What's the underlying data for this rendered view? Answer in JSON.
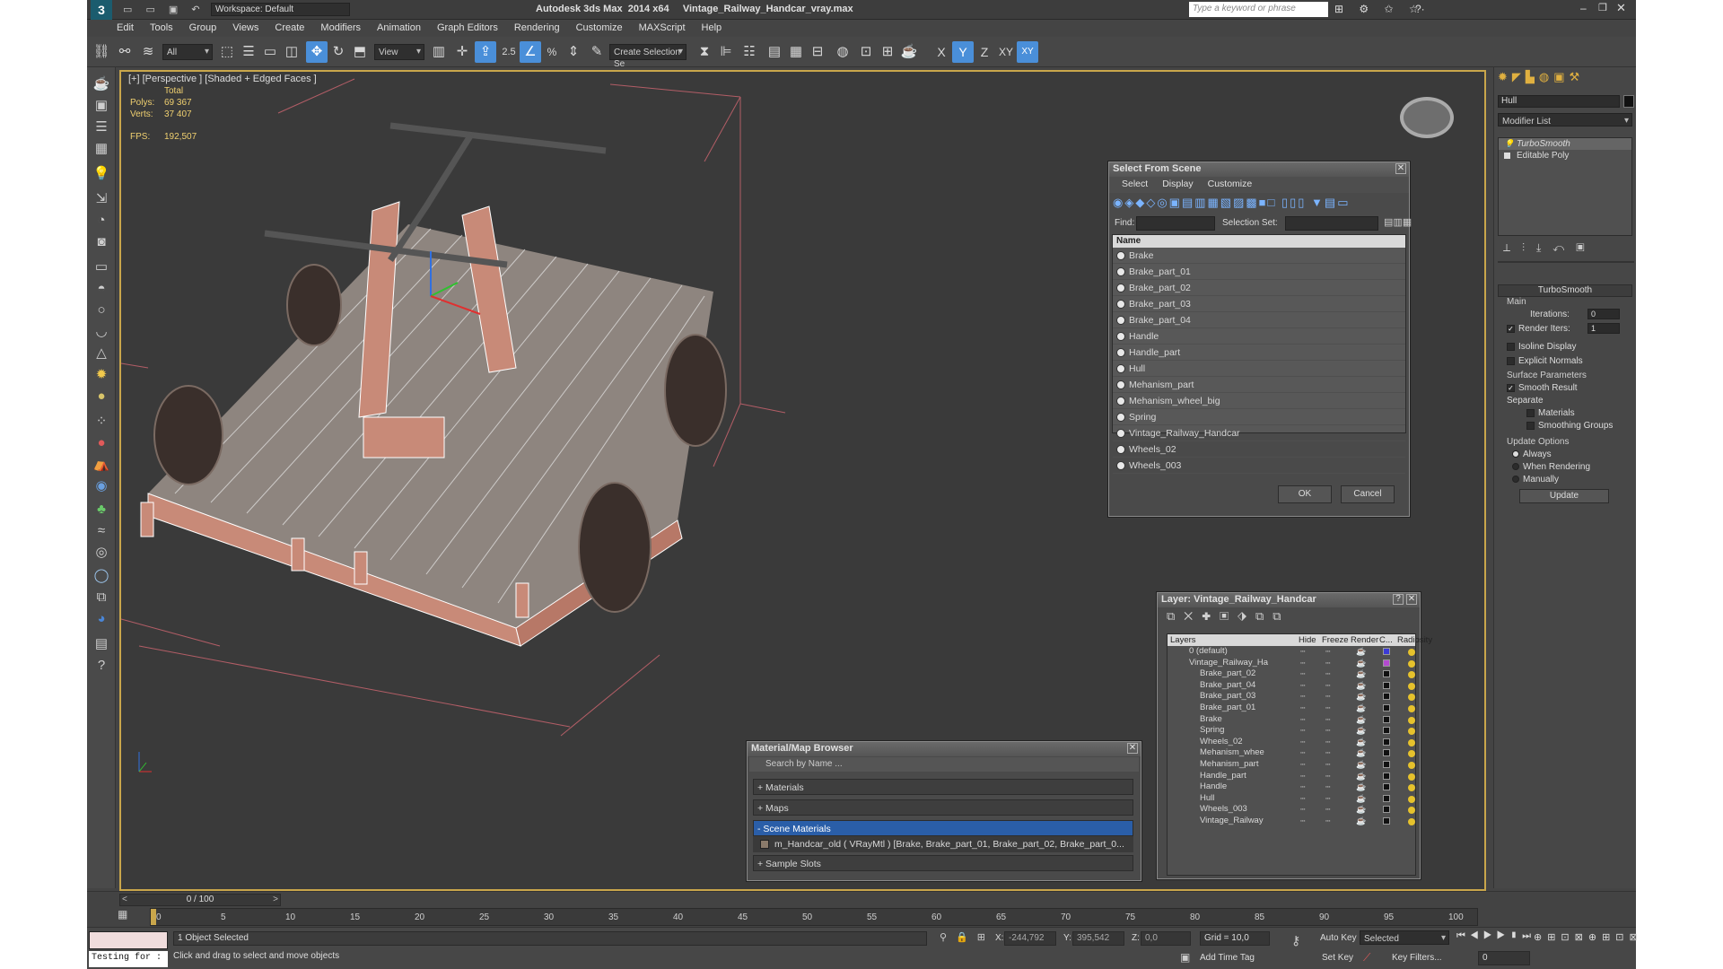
{
  "app": {
    "title": "Autodesk 3ds Max  2014 x64     Vintage_Railway_Handcar_vray.max",
    "workspace": "Workspace: Default",
    "search_placeholder": "Type a keyword or phrase"
  },
  "menu": [
    "Edit",
    "Tools",
    "Group",
    "Views",
    "Create",
    "Modifiers",
    "Animation",
    "Graph Editors",
    "Rendering",
    "Customize",
    "MAXScript",
    "Help"
  ],
  "toolbar": {
    "filter": "All",
    "ref_coord": "View",
    "snap_value": "2.5",
    "selection_set_placeholder": "Create Selection Se",
    "axes": [
      "X",
      "Y",
      "Z",
      "XY"
    ]
  },
  "viewport": {
    "label": "[+] [Perspective ] [Shaded + Edged Faces ]",
    "stats": {
      "total_label": "Total",
      "polys_label": "Polys:",
      "polys": "69 367",
      "verts_label": "Verts:",
      "verts": "37 407",
      "fps_label": "FPS:",
      "fps": "192,507"
    }
  },
  "select_from_scene": {
    "title": "Select From Scene",
    "menus": [
      "Select",
      "Display",
      "Customize"
    ],
    "find_label": "Find:",
    "selection_set_label": "Selection Set:",
    "column": "Name",
    "items": [
      "Brake",
      "Brake_part_01",
      "Brake_part_02",
      "Brake_part_03",
      "Brake_part_04",
      "Handle",
      "Handle_part",
      "Hull",
      "Mehanism_part",
      "Mehanism_wheel_big",
      "Spring",
      "Vintage_Railway_Handcar",
      "Wheels_02",
      "Wheels_003"
    ],
    "ok": "OK",
    "cancel": "Cancel"
  },
  "layer_dialog": {
    "title": "Layer: Vintage_Railway_Handcar",
    "help": "?",
    "columns": [
      "Layers",
      "Hide",
      "Freeze",
      "Render",
      "C...",
      "Radiosity"
    ],
    "layers": [
      {
        "name": "0 (default)",
        "color": "#3b3bd6"
      },
      {
        "name": "Vintage_Railway_Ha",
        "color": "#b44ad1"
      }
    ],
    "objects": [
      "Brake_part_02",
      "Brake_part_04",
      "Brake_part_03",
      "Brake_part_01",
      "Brake",
      "Spring",
      "Wheels_02",
      "Mehanism_whee",
      "Mehanism_part",
      "Handle_part",
      "Handle",
      "Hull",
      "Wheels_003",
      "Vintage_Railway"
    ]
  },
  "material_browser": {
    "title": "Material/Map Browser",
    "search_placeholder": "Search by Name ...",
    "groups": [
      "+ Materials",
      "+ Maps",
      "- Scene Materials",
      "+ Sample Slots"
    ],
    "material": "m_Handcar_old  ( VRayMtl ) [Brake, Brake_part_01, Brake_part_02, Brake_part_0..."
  },
  "command_panel": {
    "object_name": "Hull",
    "modifier_list": "Modifier List",
    "stack": [
      "TurboSmooth",
      "Editable Poly"
    ],
    "rollout": "TurboSmooth",
    "main": "Main",
    "iterations_label": "Iterations:",
    "iterations": "0",
    "render_iters_label": "Render Iters:",
    "render_iters": "1",
    "isoline": "Isoline Display",
    "explicit_normals": "Explicit Normals",
    "surface_params": "Surface Parameters",
    "smooth_result": "Smooth Result",
    "separate": "Separate",
    "materials": "Materials",
    "smoothing_groups": "Smoothing Groups",
    "update_options": "Update Options",
    "always": "Always",
    "when_rendering": "When Rendering",
    "manually": "Manually",
    "update": "Update"
  },
  "timeline": {
    "frame": "0 / 100",
    "ticks": [
      "0",
      "5",
      "10",
      "15",
      "20",
      "25",
      "30",
      "35",
      "40",
      "45",
      "50",
      "55",
      "60",
      "65",
      "70",
      "75",
      "80",
      "85",
      "90",
      "95",
      "100"
    ]
  },
  "status": {
    "maxscript": "Testing for :",
    "selected": "1 Object Selected",
    "prompt": "Click and drag to select and move objects",
    "x_label": "X:",
    "x": "-244,792",
    "y_label": "Y:",
    "y": "395,542",
    "z_label": "Z:",
    "z": "0,0",
    "grid": "Grid = 10,0",
    "add_time_tag": "Add Time Tag",
    "auto_key": "Auto Key",
    "auto_key_mode": "Selected",
    "set_key": "Set Key",
    "key_filters": "Key Filters...",
    "current_frame": "0"
  }
}
